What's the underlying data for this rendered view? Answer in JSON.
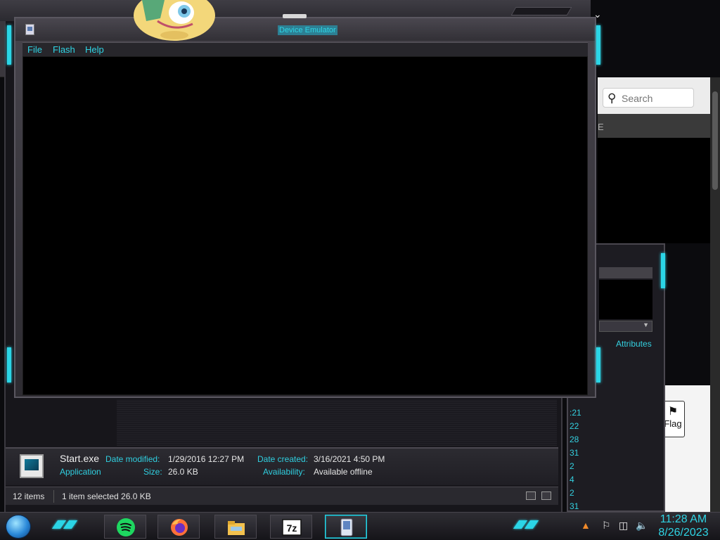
{
  "emulator": {
    "title": "Device Emulator",
    "menu": [
      "File",
      "Flash",
      "Help"
    ]
  },
  "browser": {
    "search_placeholder": "Search",
    "row_fragment": "E",
    "flag_label": "Flag"
  },
  "background_window": {
    "column_header": "Attributes",
    "row_fragments": [
      ":21",
      "22",
      "28",
      "31",
      "2",
      "4",
      "2",
      "31"
    ]
  },
  "details": {
    "file_name": "Start.exe",
    "file_type": "Application",
    "date_modified_label": "Date modified:",
    "date_modified": "1/29/2016 12:27 PM",
    "size_label": "Size:",
    "size": "26.0 KB",
    "date_created_label": "Date created:",
    "date_created": "3/16/2021 4:50 PM",
    "availability_label": "Availability:",
    "availability": "Available offline"
  },
  "status": {
    "item_count": "12 items",
    "selection": "1 item selected  26.0 KB"
  },
  "taskbar": {
    "apps": [
      "spotify-icon",
      "firefox-icon",
      "file-explorer-icon",
      "7zip-icon",
      "device-emulator-icon"
    ],
    "seven_zip_label": "7z",
    "time": "11:28 AM",
    "date": "8/26/2023"
  },
  "colors": {
    "accent": "#2fd4e4",
    "frame": "#3c3a40",
    "spotify": "#1ed760"
  }
}
